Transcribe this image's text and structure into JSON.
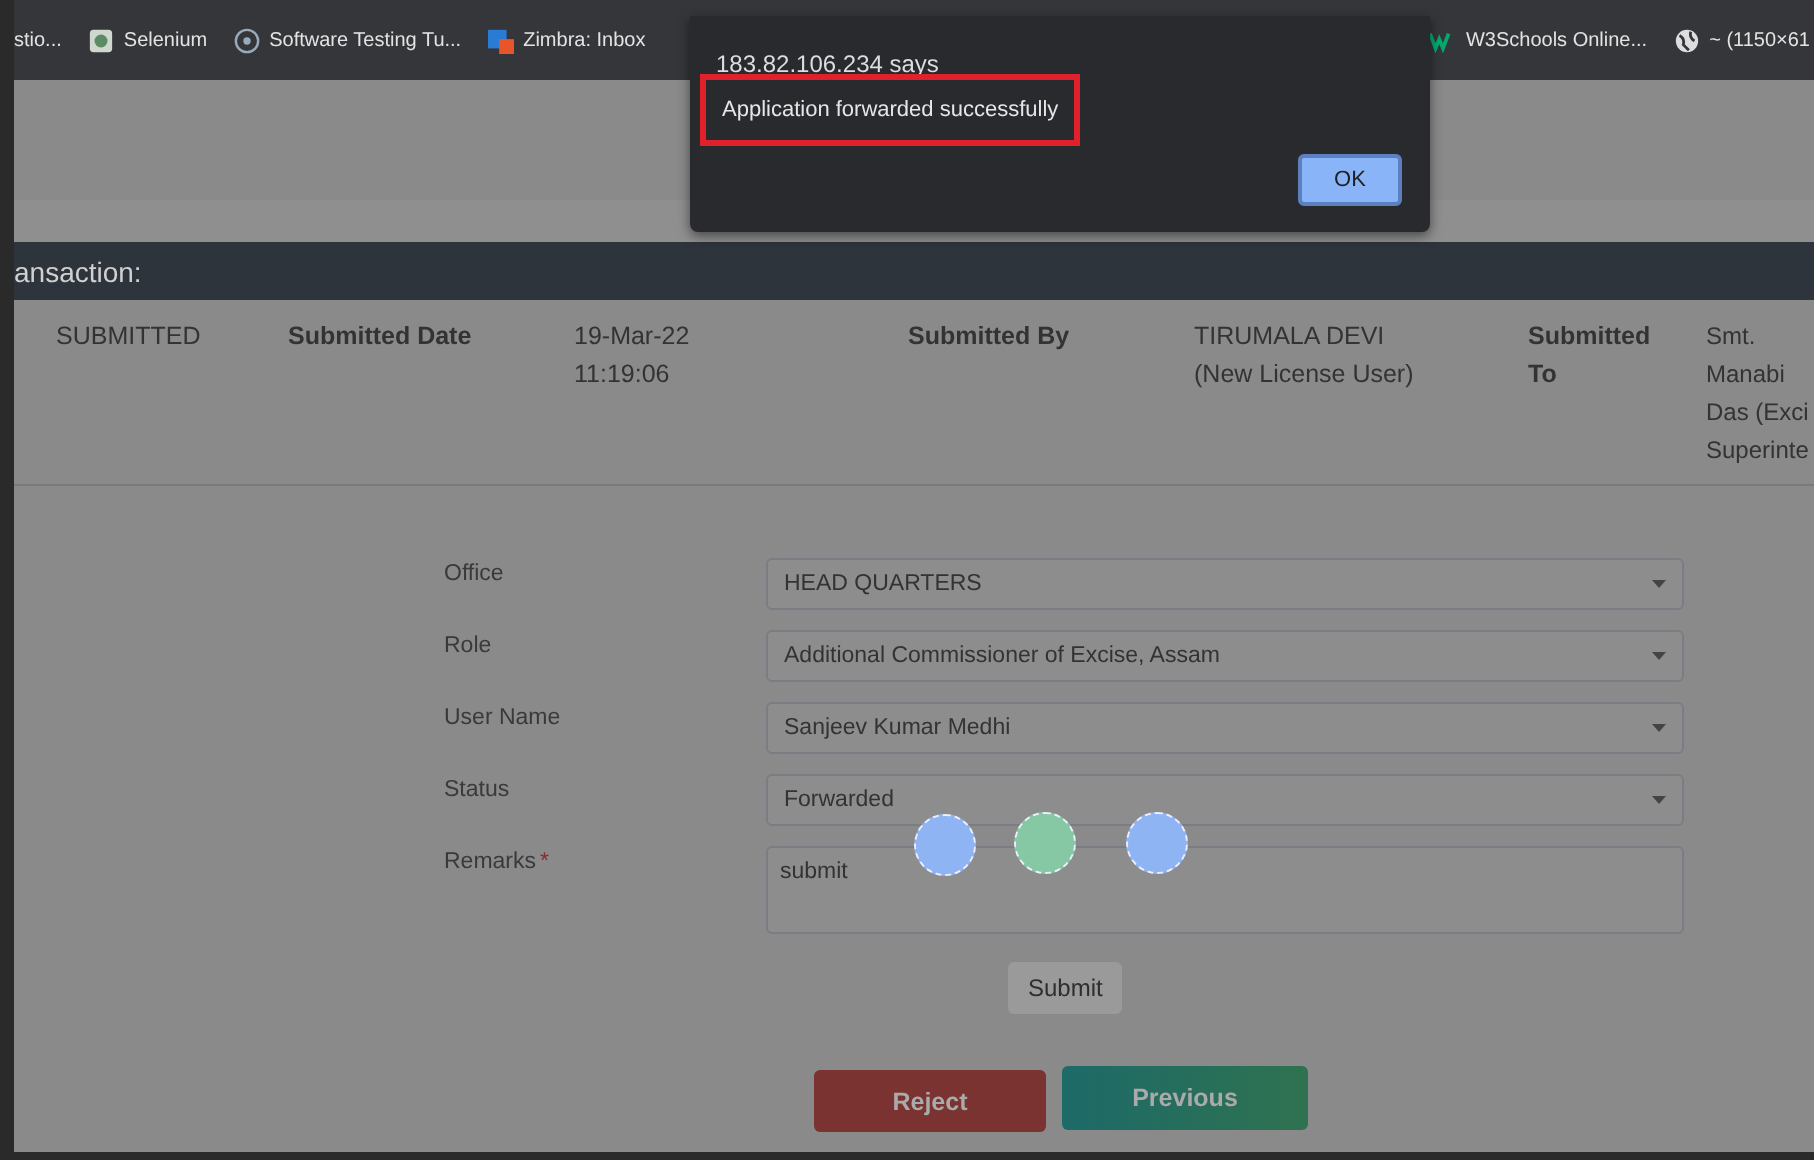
{
  "bookmarks": [
    {
      "label": "stio..."
    },
    {
      "label": "Selenium"
    },
    {
      "label": "Software Testing Tu..."
    },
    {
      "label": "Zimbra: Inbox"
    },
    {
      "label": "W3Schools Online..."
    },
    {
      "label": "~ (1150×61"
    }
  ],
  "section_header": "ansaction:",
  "details": [
    {
      "text": "SUBMITTED",
      "kind": "value"
    },
    {
      "text": "Submitted Date",
      "kind": "label"
    },
    {
      "text": "19-Mar-22 11:19:06",
      "kind": "value"
    },
    {
      "text": "Submitted By",
      "kind": "label"
    },
    {
      "text": "TIRUMALA DEVI (New License User)",
      "kind": "value"
    },
    {
      "text": "Submitted To",
      "kind": "label"
    },
    {
      "text": "Smt. Manabi Das (Exci Superinte",
      "kind": "value"
    }
  ],
  "form": [
    {
      "label": "Office",
      "kind": "select",
      "value": "HEAD QUARTERS"
    },
    {
      "label": "Role",
      "kind": "select",
      "value": "Additional Commissioner of Excise, Assam"
    },
    {
      "label": "User Name",
      "kind": "select",
      "value": "Sanjeev Kumar Medhi"
    },
    {
      "label": "Status",
      "kind": "select",
      "value": "Forwarded"
    },
    {
      "label": "Remarks",
      "kind": "textarea",
      "value": "submit",
      "required_mark": "*"
    }
  ],
  "submit_button": "Submit",
  "actions": [
    {
      "label": "Reject",
      "kind": "danger"
    },
    {
      "label": "Previous",
      "kind": "success"
    }
  ],
  "dialog": {
    "title": "183.82.106.234 says",
    "message": "Application forwarded successfully",
    "button": "OK"
  }
}
